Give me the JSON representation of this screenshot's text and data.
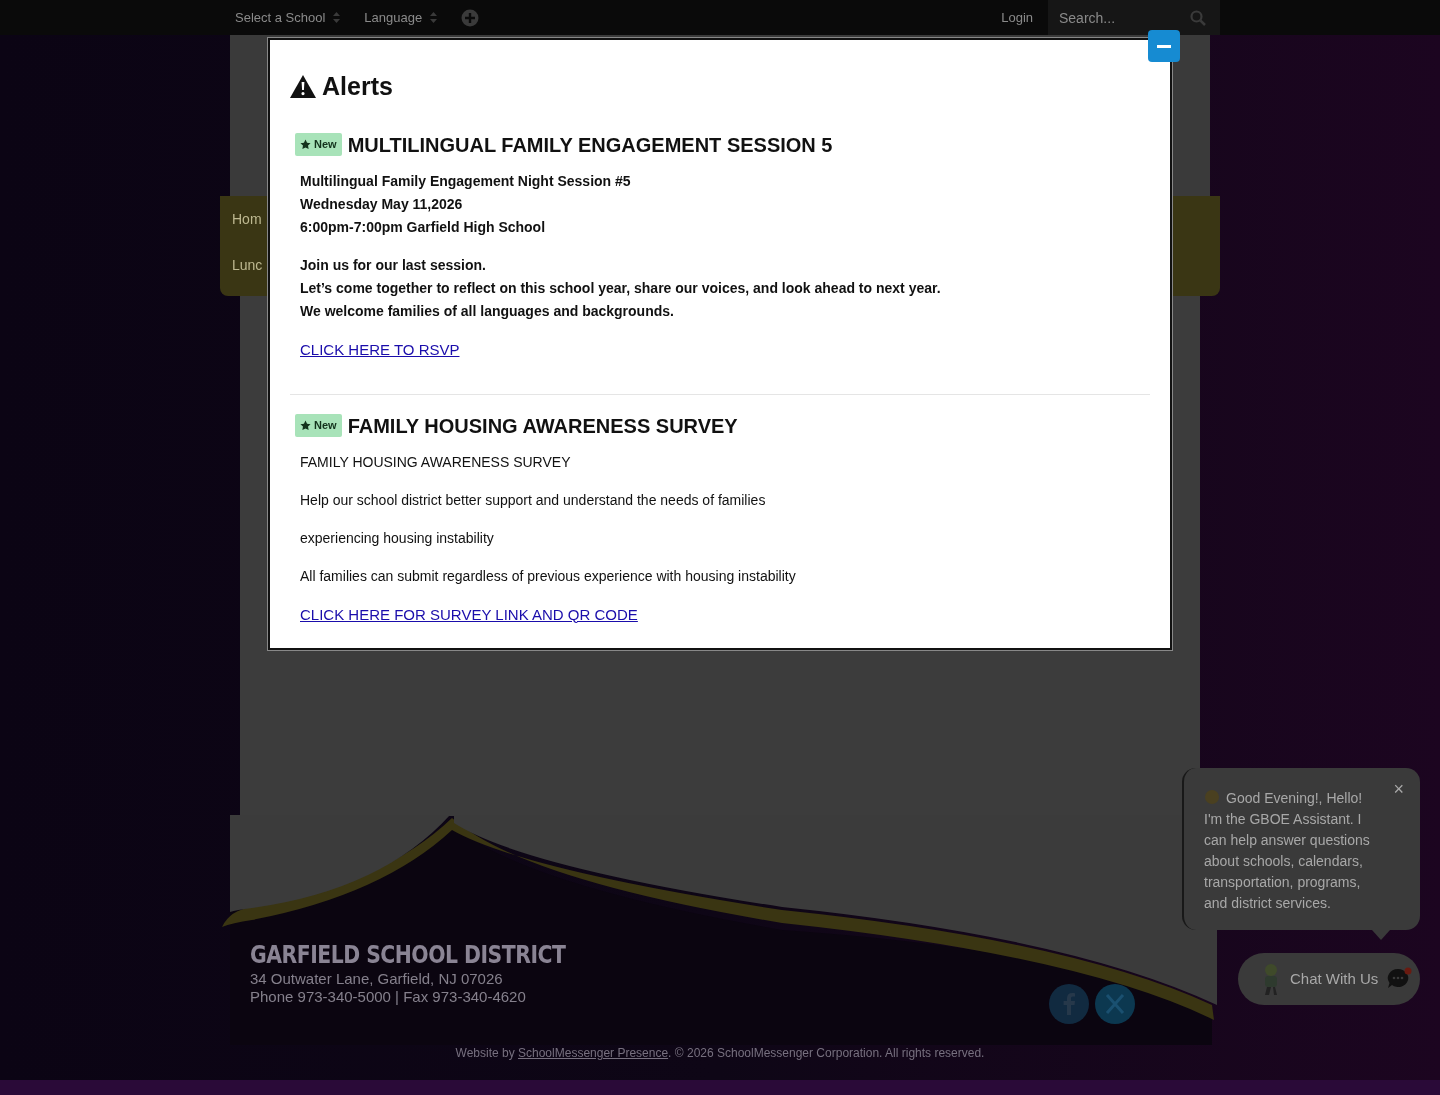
{
  "top_bar": {
    "selects": [
      "Select a School",
      "Language"
    ],
    "login": "Login",
    "search": {
      "placeholder": "Search..."
    }
  },
  "nav": [
    "Hom",
    "Lunc"
  ],
  "alerts": {
    "title": "Alerts",
    "items": [
      {
        "badge": "New",
        "title": "MULTILINGUAL FAMILY ENGAGEMENT SESSION 5",
        "bold": true,
        "paragraphs": [
          [
            "Multilingual Family Engagement Night Session #5",
            "Wednesday May 11,2026",
            "6:00pm-7:00pm Garfield High School"
          ],
          [
            "Join us for our last session.",
            "Let’s come together to reflect on this school year, share our voices, and look ahead to next year.",
            "We welcome families of all languages and backgrounds."
          ]
        ],
        "link": "CLICK HERE TO RSVP"
      },
      {
        "badge": "New",
        "title": "FAMILY HOUSING AWARENESS SURVEY",
        "bold": false,
        "paragraphs": [
          [
            "FAMILY HOUSING AWARENESS SURVEY"
          ],
          [
            "Help our school district better support and understand the needs of families"
          ],
          [
            "experiencing housing instability"
          ],
          [
            "All families can submit regardless of previous experience with housing instability"
          ]
        ],
        "link": "CLICK HERE FOR SURVEY LINK AND QR CODE"
      }
    ]
  },
  "footer": {
    "name": "GARFIELD SCHOOL DISTRICT",
    "address": "34 Outwater Lane, Garfield, NJ 07026",
    "phone": "Phone 973-340-5000 | Fax 973-340-4620",
    "credit_prefix": "Website by",
    "credit_link": "SchoolMessenger Presence",
    "credit_suffix": ". © 2026 SchoolMessenger Corporation. All rights reserved."
  },
  "chat": {
    "greeting": "Good Evening!, Hello! I'm the GBOE Assistant. I can help answer questions about schools, calendars, transportation, programs, and district services.",
    "close": "×",
    "button": "Chat With Us"
  }
}
